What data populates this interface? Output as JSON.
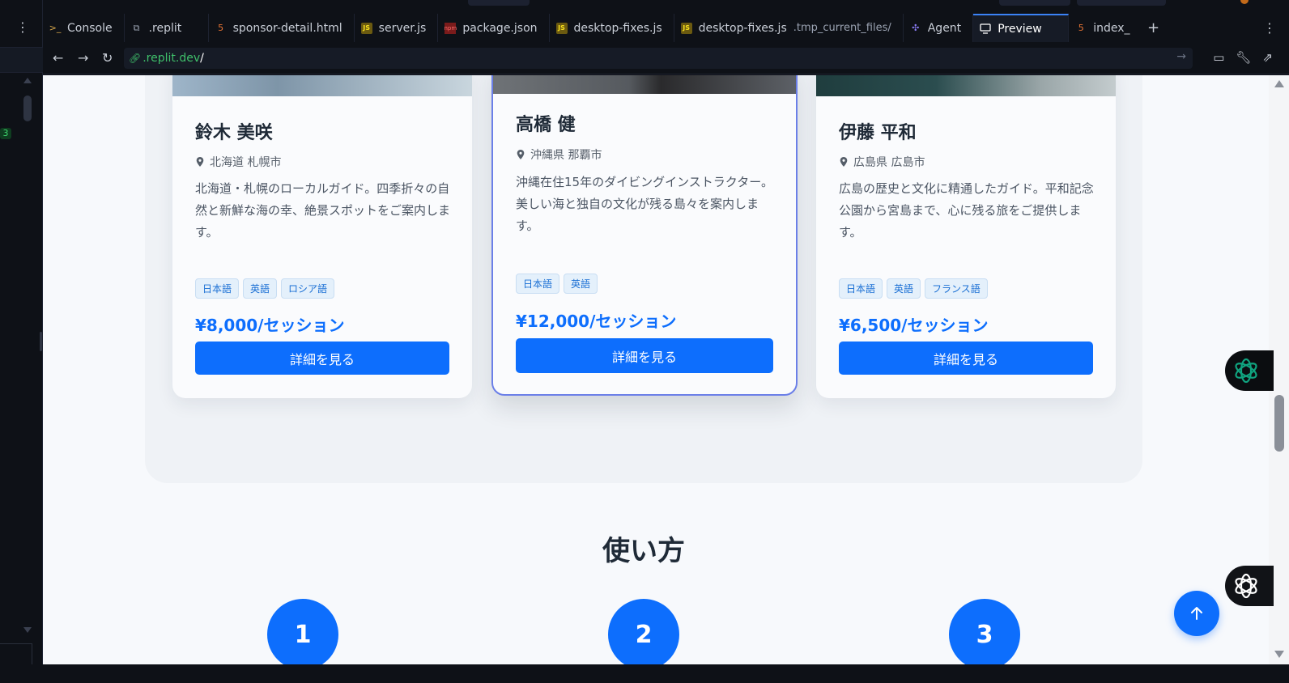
{
  "editor": {
    "left_panel_badge": "3",
    "tabs": [
      {
        "label": "Console",
        "icon": "terminal-icon"
      },
      {
        "label": ".replit",
        "icon": "replit-icon"
      },
      {
        "label": "sponsor-detail.html",
        "icon": "html-file-icon"
      },
      {
        "label": "server.js",
        "icon": "js-file-icon"
      },
      {
        "label": "package.json",
        "icon": "npm-icon"
      },
      {
        "label": "desktop-fixes.js",
        "icon": "js-file-icon"
      },
      {
        "label": "desktop-fixes.js",
        "sublabel": ".tmp_current_files/",
        "icon": "js-file-icon"
      },
      {
        "label": "Agent",
        "icon": "agent-icon"
      },
      {
        "label": "Preview",
        "icon": "monitor-icon",
        "active": true
      },
      {
        "label": "index_",
        "icon": "html-file-icon"
      }
    ],
    "url": {
      "host": ".replit.dev",
      "path": "/"
    }
  },
  "guides": [
    {
      "name": "鈴木 美咲",
      "location": "北海道 札幌市",
      "description": "北海道・札幌のローカルガイド。四季折々の自然と新鮮な海の幸、絶景スポットをご案内します。",
      "languages": [
        "日本語",
        "英語",
        "ロシア語"
      ],
      "price": "¥8,000/セッション",
      "button": "詳細を見る"
    },
    {
      "name": "高橋 健",
      "location": "沖縄県 那覇市",
      "description": "沖縄在住15年のダイビングインストラクター。美しい海と独自の文化が残る島々を案内します。",
      "languages": [
        "日本語",
        "英語"
      ],
      "price": "¥12,000/セッション",
      "button": "詳細を見る"
    },
    {
      "name": "伊藤 平和",
      "location": "広島県 広島市",
      "description": "広島の歴史と文化に精通したガイド。平和記念公園から宮島まで、心に残る旅をご提供します。",
      "languages": [
        "日本語",
        "英語",
        "フランス語"
      ],
      "price": "¥6,500/セッション",
      "button": "詳細を見る"
    }
  ],
  "how_to": {
    "title": "使い方",
    "steps": [
      "1",
      "2",
      "3"
    ]
  },
  "colors": {
    "primary": "#0d6efd",
    "highlight_border": "#6b7fe8",
    "tag_bg": "#e4f0fb"
  }
}
